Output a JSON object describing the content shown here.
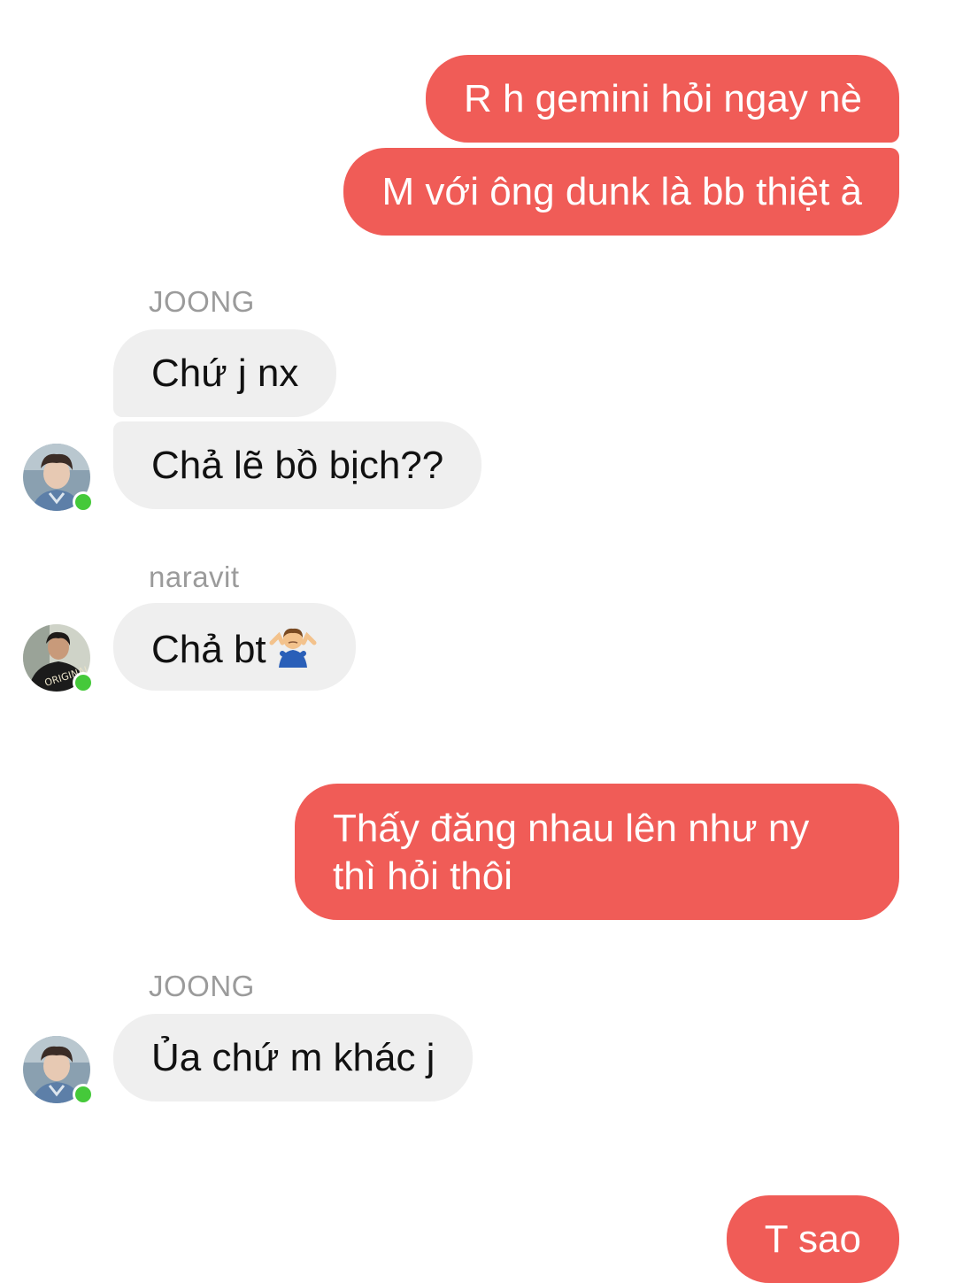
{
  "colors": {
    "outgoing_bubble": "#f05c57",
    "incoming_bubble": "#efefef",
    "online_dot": "#45c93a",
    "sender_name": "#9b9b9b"
  },
  "messages": [
    {
      "direction": "out",
      "text": "R h gemini hỏi ngay nè"
    },
    {
      "direction": "out",
      "text": "M với ông dunk là bb thiệt à"
    },
    {
      "direction": "in",
      "sender": "JOONG",
      "text": "Chứ j nx"
    },
    {
      "direction": "in",
      "sender": "JOONG",
      "text": "Chả lẽ bồ bịch??"
    },
    {
      "direction": "in",
      "sender": "naravit",
      "text": "Chả bt",
      "emoji": "person-shrugging-icon"
    },
    {
      "direction": "out",
      "text_line1": "Thấy đăng nhau lên như ny",
      "text_line2": "thì hỏi thôi"
    },
    {
      "direction": "in",
      "sender": "JOONG",
      "text": "Ủa chứ m khác j"
    },
    {
      "direction": "out",
      "text": "T sao"
    }
  ]
}
